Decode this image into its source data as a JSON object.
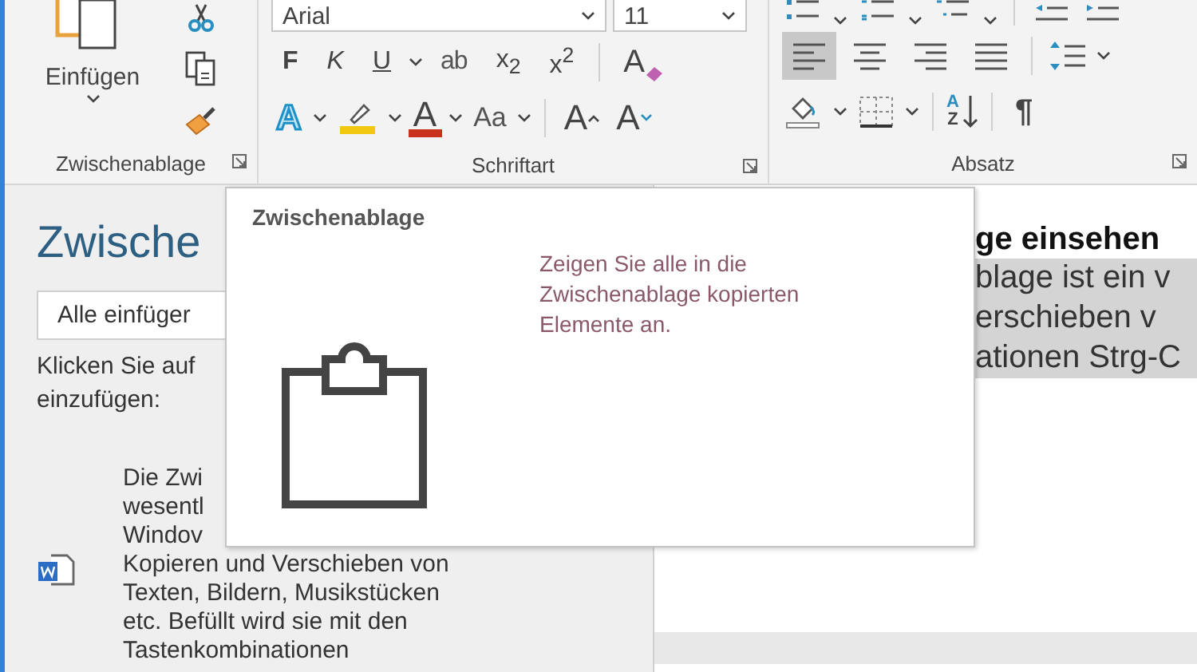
{
  "ribbon": {
    "clipboard": {
      "label": "Zwischenablage",
      "paste_label": "Einfügen"
    },
    "font": {
      "label": "Schriftart",
      "font_name": "Arial",
      "font_size": "11",
      "format_buttons": [
        {
          "kind": "bold",
          "text": "F"
        },
        {
          "kind": "italic",
          "text": "K"
        },
        {
          "kind": "underline",
          "text": "U"
        },
        {
          "kind": "strikethrough",
          "text": "ab"
        },
        {
          "kind": "subscript",
          "text": "x$_{2}$"
        },
        {
          "kind": "superscript",
          "text": "x$^{2}$"
        },
        {
          "kind": "clear-formatting",
          "text": "A"
        }
      ],
      "effect_buttons": [
        {
          "kind": "text-effects",
          "text": "A"
        },
        {
          "kind": "highlight"
        },
        {
          "kind": "font-color",
          "text": "A"
        },
        {
          "kind": "change-case",
          "text": "Aa"
        },
        {
          "kind": "grow",
          "text": "A"
        },
        {
          "kind": "shrink",
          "text": "A"
        }
      ]
    },
    "paragraph": {
      "label": "Absatz",
      "alignment": [
        {
          "kind": "left",
          "selected": true
        },
        {
          "kind": "center",
          "selected": false
        },
        {
          "kind": "right",
          "selected": false
        },
        {
          "kind": "justify",
          "selected": false
        }
      ],
      "sort": {
        "top": "A",
        "bottom": "Z"
      },
      "pilcrow": "¶"
    }
  },
  "task_pane": {
    "title": "Zwische",
    "paste_all_button": "Alle einfüger",
    "instruction_lines": [
      "Klicken Sie auf",
      "einzufügen:"
    ],
    "item_lines": [
      "Die Zwi",
      "wesentl",
      "Windov",
      "Kopieren und Verschieben von",
      "Texten, Bildern, Musikstücken",
      "etc. Befüllt wird sie mit den",
      "Tastenkombinationen"
    ]
  },
  "document": {
    "heading": "ge einsehen",
    "lines": [
      "blage ist ein v",
      "erschieben v",
      "ationen Strg-C"
    ]
  },
  "tooltip": {
    "title": "Zwischenablage",
    "description": "Zeigen Sie alle in die Zwischenablage kopierten Elemente an."
  }
}
